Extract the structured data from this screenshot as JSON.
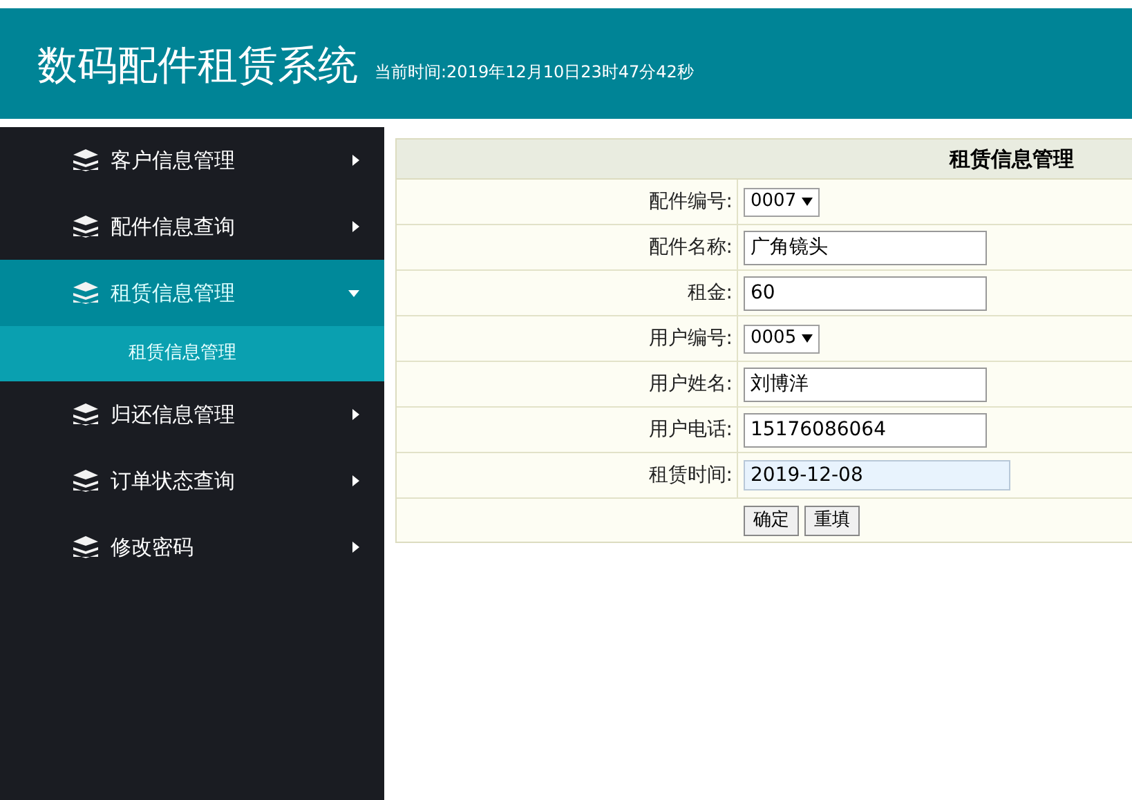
{
  "header": {
    "title": "数码配件租赁系统",
    "clock": "当前时间:2019年12月10日23时47分42秒"
  },
  "sidebar": {
    "items": [
      {
        "label": "客户信息管理",
        "expanded": false
      },
      {
        "label": "配件信息查询",
        "expanded": false
      },
      {
        "label": "租赁信息管理",
        "expanded": true,
        "children": [
          {
            "label": "租赁信息管理"
          }
        ]
      },
      {
        "label": "归还信息管理",
        "expanded": false
      },
      {
        "label": "订单状态查询",
        "expanded": false
      },
      {
        "label": "修改密码",
        "expanded": false
      }
    ]
  },
  "form": {
    "title": "租赁信息管理",
    "fields": [
      {
        "label": "配件编号:",
        "kind": "select",
        "value": "0007"
      },
      {
        "label": "配件名称:",
        "kind": "text",
        "value": "广角镜头"
      },
      {
        "label": "租金:",
        "kind": "text",
        "value": "60"
      },
      {
        "label": "用户编号:",
        "kind": "select",
        "value": "0005"
      },
      {
        "label": "用户姓名:",
        "kind": "text",
        "value": "刘博洋"
      },
      {
        "label": "用户电话:",
        "kind": "text",
        "value": "15176086064"
      },
      {
        "label": "租赁时间:",
        "kind": "date",
        "value": "2019-12-08"
      }
    ],
    "buttons": [
      "确定",
      "重填"
    ]
  }
}
